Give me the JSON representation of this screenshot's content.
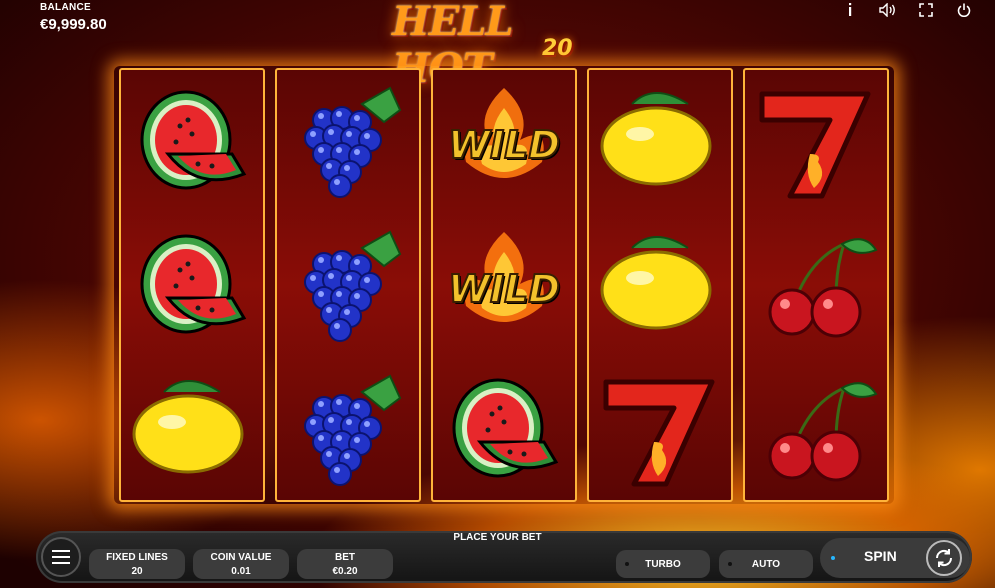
{
  "balance": {
    "label": "BALANCE",
    "value": "€9,999.80"
  },
  "logo": {
    "title": "HELL HOT",
    "number": "20"
  },
  "top_icons": [
    "info-icon",
    "sound-icon",
    "fullscreen-icon",
    "power-icon"
  ],
  "reels": [
    [
      "watermelon",
      "watermelon",
      "lemon"
    ],
    [
      "grapes",
      "grapes",
      "grapes"
    ],
    [
      "wild",
      "wild",
      "watermelon"
    ],
    [
      "lemon",
      "lemon",
      "seven"
    ],
    [
      "seven",
      "cherries",
      "cherries"
    ]
  ],
  "wild_text": "WILD",
  "controls": {
    "prompt": "PLACE YOUR BET",
    "fixed_lines": {
      "label": "FIXED LINES",
      "value": "20"
    },
    "coin_value": {
      "label": "COIN VALUE",
      "value": "0.01"
    },
    "bet": {
      "label": "BET",
      "value": "€0.20"
    },
    "turbo": "TURBO",
    "auto": "AUTO",
    "spin": "SPIN"
  },
  "colors": {
    "reel_border": "#ffb43a",
    "spin_indicator": "#27b7ff",
    "panel": "#3c3c3c"
  }
}
